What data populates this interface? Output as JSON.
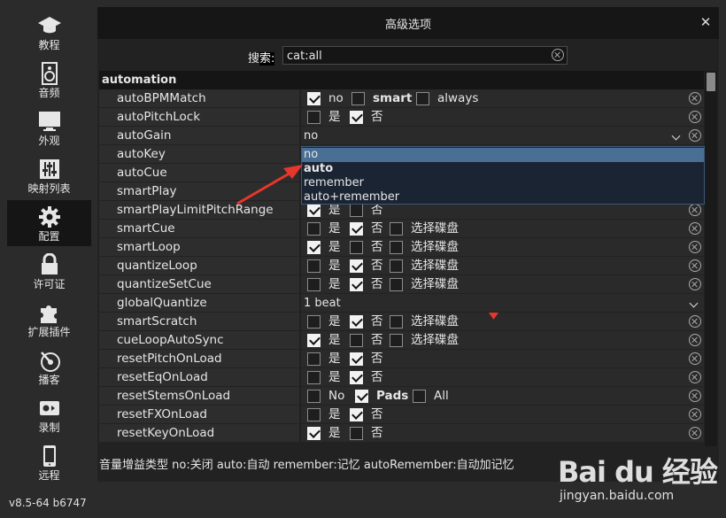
{
  "sidebar": {
    "items": [
      {
        "label": "教程",
        "icon": "graduation-cap-icon"
      },
      {
        "label": "音频",
        "icon": "speaker-icon"
      },
      {
        "label": "外观",
        "icon": "monitor-icon"
      },
      {
        "label": "映射列表",
        "icon": "sliders-icon"
      },
      {
        "label": "配置",
        "icon": "gear-icon",
        "active": true
      },
      {
        "label": "许可证",
        "icon": "lock-icon"
      },
      {
        "label": "扩展插件",
        "icon": "puzzle-icon"
      },
      {
        "label": "播客",
        "icon": "podcast-icon"
      },
      {
        "label": "录制",
        "icon": "record-icon"
      },
      {
        "label": "远程",
        "icon": "phone-icon"
      }
    ],
    "version": "v8.5-64 b6747"
  },
  "dialog": {
    "title": "高级选项",
    "close_glyph": "✕",
    "search_label_prefix": "搜",
    "search_label_highlight": "索:",
    "search_value": "cat:all"
  },
  "section": "automation",
  "rows": [
    {
      "name": "autoBPMMatch",
      "opt1": "no",
      "opt2": "smart",
      "opt3": "always"
    },
    {
      "name": "autoPitchLock",
      "opt1": "是",
      "opt2": "否"
    },
    {
      "name": "autoGain",
      "select": "no"
    },
    {
      "name": "autoKey"
    },
    {
      "name": "autoCue"
    },
    {
      "name": "smartPlay"
    },
    {
      "name": "smartPlayLimitPitchRange",
      "opt1": "是",
      "opt2": "否"
    },
    {
      "name": "smartCue",
      "opt1": "是",
      "opt2": "否",
      "opt3": "选择碟盘"
    },
    {
      "name": "smartLoop",
      "opt1": "是",
      "opt2": "否",
      "opt3": "选择碟盘"
    },
    {
      "name": "quantizeLoop",
      "opt1": "是",
      "opt2": "否",
      "opt3": "选择碟盘"
    },
    {
      "name": "quantizeSetCue",
      "opt1": "是",
      "opt2": "否",
      "opt3": "选择碟盘"
    },
    {
      "name": "globalQuantize",
      "select": "1 beat"
    },
    {
      "name": "smartScratch",
      "opt1": "是",
      "opt2": "否",
      "opt3": "选择碟盘"
    },
    {
      "name": "cueLoopAutoSync",
      "opt1": "是",
      "opt2": "否",
      "opt3": "选择碟盘"
    },
    {
      "name": "resetPitchOnLoad",
      "opt1": "是",
      "opt2": "否"
    },
    {
      "name": "resetEqOnLoad",
      "opt1": "是",
      "opt2": "否"
    },
    {
      "name": "resetStemsOnLoad",
      "opt1": "No",
      "opt2": "Pads",
      "opt3": "All"
    },
    {
      "name": "resetFXOnLoad",
      "opt1": "是",
      "opt2": "否"
    },
    {
      "name": "resetKeyOnLoad",
      "opt1": "是",
      "opt2": "否"
    }
  ],
  "dropdown": {
    "options": [
      "no",
      "auto",
      "remember",
      "auto+remember"
    ],
    "highlighted": "no",
    "bold": "auto"
  },
  "footer": {
    "text": "音量增益类型   no:关闭   auto:自动   remember:记忆   autoRemember:自动加记忆"
  },
  "watermark": {
    "logo": "Bai du 经验",
    "url": "jingyan.baidu.com"
  },
  "colors": {
    "background": "#2b2b2b",
    "panel": "#222222",
    "dropdown_highlight": "#4a6f94",
    "annotation_arrow": "#e8362c"
  }
}
